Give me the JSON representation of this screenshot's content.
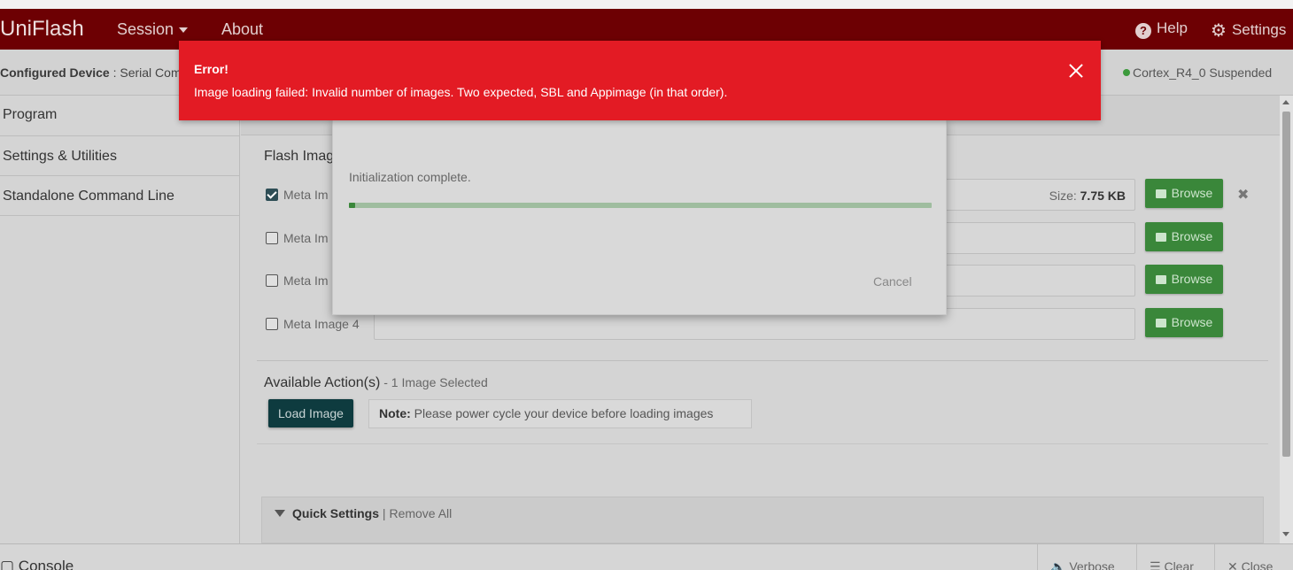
{
  "app": {
    "brand": "UniFlash"
  },
  "nav": {
    "session": "Session",
    "about": "About",
    "help": "Help",
    "settings": "Settings"
  },
  "device": {
    "label": "Configured Device",
    "sep": ":",
    "value": "Serial Com",
    "status": "Cortex_R4_0 Suspended",
    "status_color": "#3c9a3c"
  },
  "sidebar": {
    "items": [
      {
        "label": "Program"
      },
      {
        "label": "Settings & Utilities"
      },
      {
        "label": "Standalone Command Line"
      }
    ]
  },
  "flash": {
    "title": "Flash Imag",
    "images": [
      {
        "label": "Meta Im",
        "checked": true,
        "size_label": "Size:",
        "size_value": "7.75 KB",
        "browse": "Browse"
      },
      {
        "label": "Meta Im",
        "checked": false,
        "browse": "Browse"
      },
      {
        "label": "Meta Im",
        "checked": false,
        "browse": "Browse"
      },
      {
        "label": "Meta Image 4",
        "checked": false,
        "browse": "Browse"
      }
    ]
  },
  "actions": {
    "title": "Available Action(s)",
    "subtitle": " - 1 Image Selected",
    "load_button": "Load Image",
    "note_label": "Note:",
    "note_text": " Please power cycle your device before loading images"
  },
  "quick_settings": {
    "title": "Quick Settings",
    "separator": " | ",
    "remove_all": "Remove All"
  },
  "console": {
    "title": "Console",
    "verbose": "Verbose",
    "clear": "Clear",
    "close": "Close"
  },
  "dialog": {
    "message": "Initialization complete.",
    "progress": 0.01,
    "cancel": "Cancel"
  },
  "error": {
    "title": "Error!",
    "message": "Image loading failed: Invalid number of images. Two expected, SBL and Appimage (in that order).",
    "color": "#e31b24"
  }
}
